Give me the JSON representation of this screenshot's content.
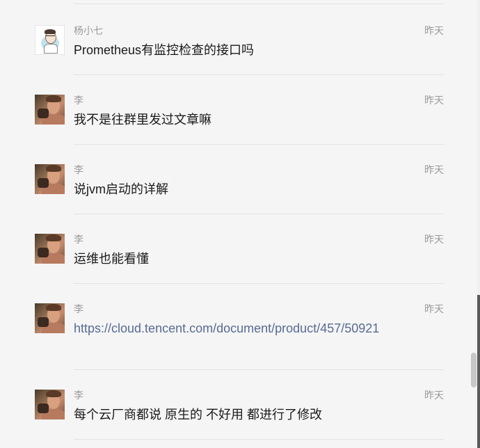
{
  "messages": [
    {
      "sender": "杨小七",
      "time": "昨天",
      "text": "Prometheus有监控检查的接口吗",
      "avatar": "cartoon-avatar",
      "is_link": false
    },
    {
      "sender": "李",
      "time": "昨天",
      "text": "我不是往群里发过文章嘛",
      "avatar": "photo-avatar",
      "is_link": false
    },
    {
      "sender": "李",
      "time": "昨天",
      "text": "说jvm启动的详解",
      "avatar": "photo-avatar",
      "is_link": false
    },
    {
      "sender": "李",
      "time": "昨天",
      "text": "运维也能看懂",
      "avatar": "photo-avatar",
      "is_link": false
    },
    {
      "sender": "李",
      "time": "昨天",
      "text": "https://cloud.tencent.com/document/product/457/50921",
      "avatar": "photo-avatar",
      "is_link": true
    },
    {
      "sender": "李",
      "time": "昨天",
      "text": "每个云厂商都说 原生的 不好用 都进行了修改",
      "avatar": "photo-avatar",
      "is_link": false
    }
  ],
  "colors": {
    "background": "#f5f5f5",
    "meta_text": "#9a9a9a",
    "message_text": "#1a1a1a",
    "link_text": "#576b95",
    "divider": "#e2e2e2"
  }
}
